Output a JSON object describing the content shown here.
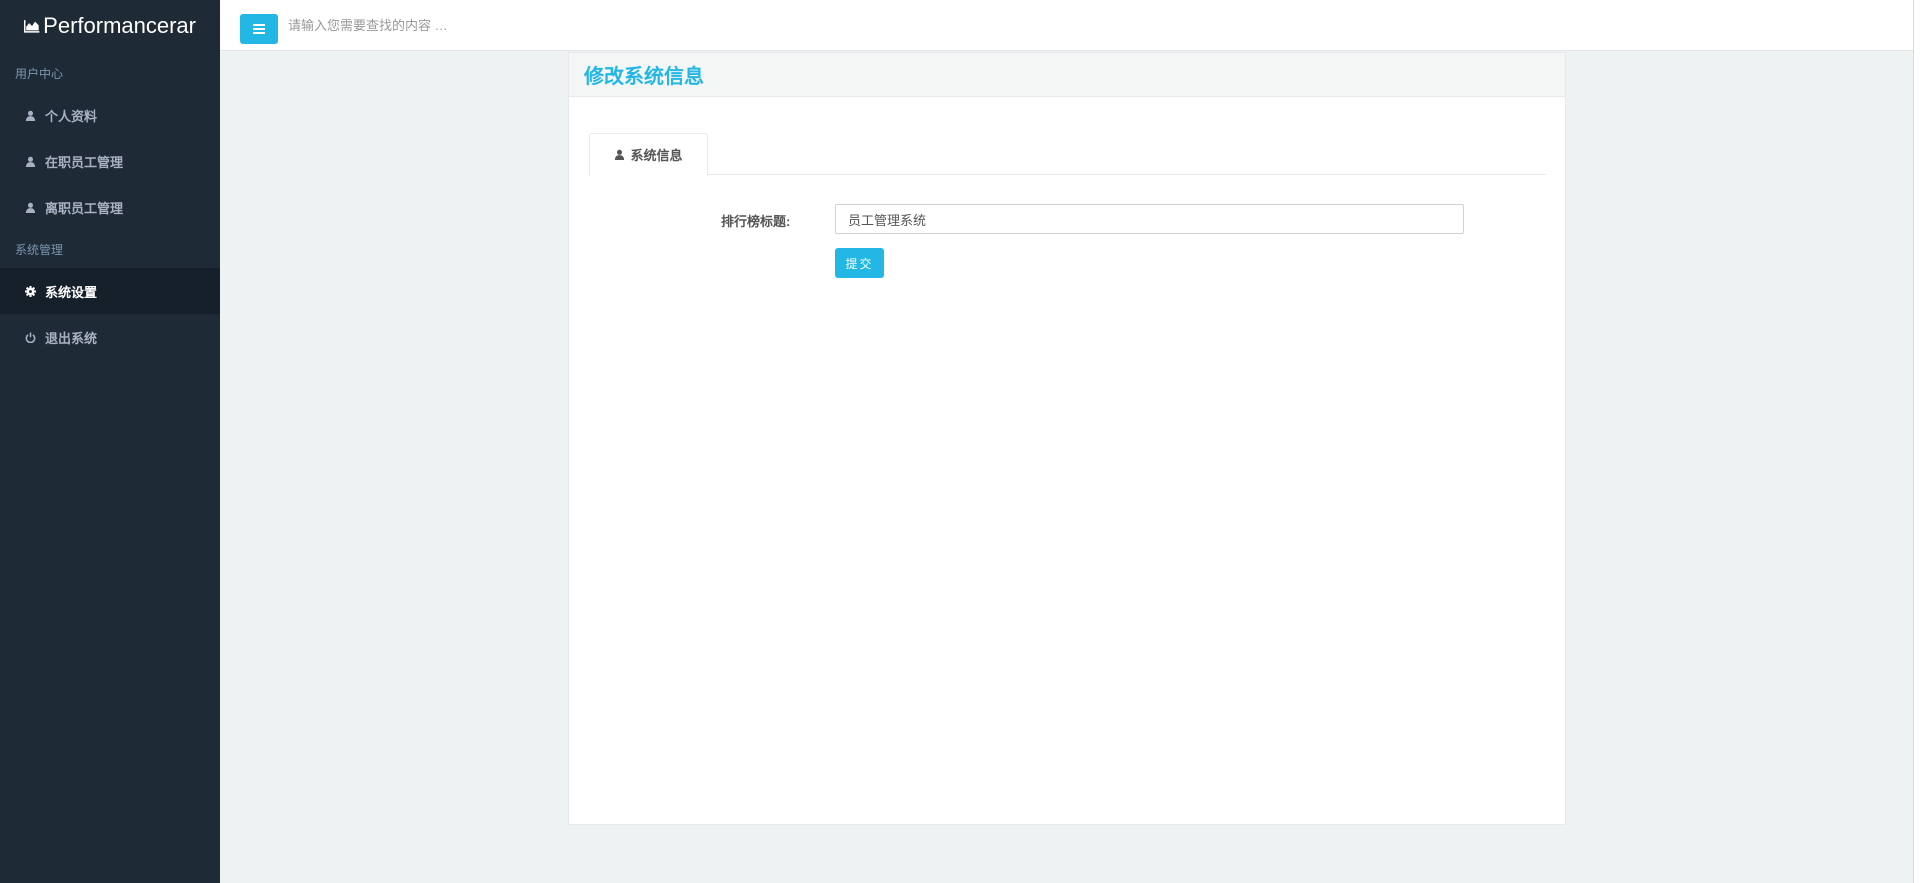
{
  "app": {
    "brand": "Performancerar"
  },
  "sidebar": {
    "sections": [
      {
        "title": "用户中心",
        "items": [
          {
            "label": "个人资料",
            "icon": "user-icon"
          },
          {
            "label": "在职员工管理",
            "icon": "user-icon"
          },
          {
            "label": "离职员工管理",
            "icon": "user-icon"
          }
        ]
      },
      {
        "title": "系统管理",
        "items": [
          {
            "label": "系统设置",
            "icon": "gear-icon",
            "active": true
          },
          {
            "label": "退出系统",
            "icon": "power-icon"
          }
        ]
      }
    ]
  },
  "topbar": {
    "search_placeholder": "请输入您需要查找的内容 …",
    "menu_icon": "hamburger-icon"
  },
  "panel": {
    "title": "修改系统信息",
    "tab_label": "系统信息",
    "form": {
      "label": "排行榜标题:",
      "value": "员工管理系统",
      "submit_label": "提交"
    }
  },
  "colors": {
    "accent": "#23b7e5",
    "sidebar_bg": "#1e2a35",
    "sidebar_active": "#16202a",
    "page_bg": "#eff2f3"
  }
}
